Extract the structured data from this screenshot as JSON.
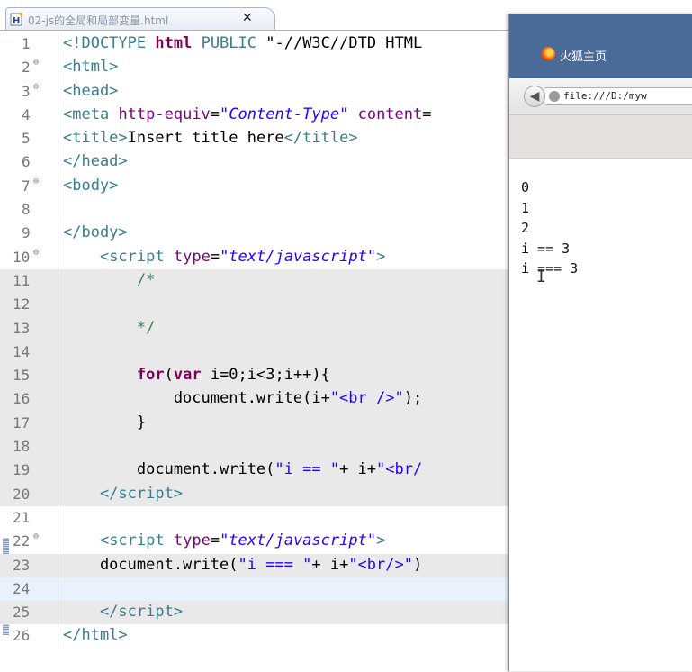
{
  "editor_tab": {
    "title": "02-js的全局和局部变量.html",
    "close_label": "✕"
  },
  "code_lines": [
    {
      "n": "1",
      "fold": "",
      "bg": "",
      "html": "<span class='tk-tag'>&lt;!DOCTYPE</span> <span class='tk-kw'>html</span> <span class='tk-tag'>PUBLIC</span> <span class='tk-str' style='color:#000'>\"-//W3C//DTD HTML</span>"
    },
    {
      "n": "2",
      "fold": "⊖",
      "bg": "",
      "html": "<span class='tk-tag'>&lt;html&gt;</span>"
    },
    {
      "n": "3",
      "fold": "⊖",
      "bg": "",
      "html": "<span class='tk-tag'>&lt;head&gt;</span>"
    },
    {
      "n": "4",
      "fold": "",
      "bg": "",
      "html": "<span class='tk-tag'>&lt;meta</span> <span class='tk-attr'>http-equiv</span>=<span class='tk-attrval'>\"Content-Type\"</span> <span class='tk-attr'>content</span>="
    },
    {
      "n": "5",
      "fold": "",
      "bg": "",
      "html": "<span class='tk-tag'>&lt;title&gt;</span>Insert title here<span class='tk-tag'>&lt;/title&gt;</span>"
    },
    {
      "n": "6",
      "fold": "",
      "bg": "",
      "html": "<span class='tk-tag'>&lt;/head&gt;</span>"
    },
    {
      "n": "7",
      "fold": "⊖",
      "bg": "",
      "html": "<span class='tk-tag'>&lt;body&gt;</span>"
    },
    {
      "n": "8",
      "fold": "",
      "bg": "",
      "html": ""
    },
    {
      "n": "9",
      "fold": "",
      "bg": "",
      "html": "<span class='tk-tag'>&lt;/body&gt;</span>"
    },
    {
      "n": "10",
      "fold": "⊖",
      "bg": "",
      "html": "    <span class='tk-tag'>&lt;script</span> <span class='tk-attr'>type</span>=<span class='tk-attrval'>\"text/javascript\"</span><span class='tk-tag'>&gt;</span>"
    },
    {
      "n": "11",
      "fold": "",
      "bg": "gray",
      "html": "        <span class='tk-cmt'>/*</span>"
    },
    {
      "n": "12",
      "fold": "",
      "bg": "gray",
      "html": ""
    },
    {
      "n": "13",
      "fold": "",
      "bg": "gray",
      "html": "        <span class='tk-cmt'>*/</span>"
    },
    {
      "n": "14",
      "fold": "",
      "bg": "gray",
      "html": ""
    },
    {
      "n": "15",
      "fold": "",
      "bg": "gray",
      "html": "        <span class='tk-kw'>for</span>(<span class='tk-kw'>var</span> i=0;i&lt;3;i++){"
    },
    {
      "n": "16",
      "fold": "",
      "bg": "gray",
      "html": "            document.write(i+<span class='tk-str'>\"&lt;br /&gt;\"</span>);"
    },
    {
      "n": "17",
      "fold": "",
      "bg": "gray",
      "html": "        }"
    },
    {
      "n": "18",
      "fold": "",
      "bg": "gray",
      "html": ""
    },
    {
      "n": "19",
      "fold": "",
      "bg": "gray",
      "html": "        document.write(<span class='tk-str'>\"i == \"</span>+ i+<span class='tk-str'>\"&lt;br/</span>"
    },
    {
      "n": "20",
      "fold": "",
      "bg": "gray",
      "html": "    <span class='tk-tag'>&lt;/script&gt;</span>"
    },
    {
      "n": "21",
      "fold": "",
      "bg": "",
      "html": ""
    },
    {
      "n": "22",
      "fold": "⊖",
      "bg": "",
      "html": "    <span class='tk-tag'>&lt;script</span> <span class='tk-attr'>type</span>=<span class='tk-attrval'>\"text/javascript\"</span><span class='tk-tag'>&gt;</span>"
    },
    {
      "n": "23",
      "fold": "",
      "bg": "gray",
      "html": "    document.write(<span class='tk-str'>\"i === \"</span>+ i+<span class='tk-str'>\"&lt;br/&gt;\"</span>)"
    },
    {
      "n": "24",
      "fold": "",
      "bg": "current",
      "html": ""
    },
    {
      "n": "25",
      "fold": "",
      "bg": "gray",
      "html": "    <span class='tk-tag'>&lt;/script&gt;</span>"
    },
    {
      "n": "26",
      "fold": "",
      "bg": "",
      "html": "<span class='tk-tag'>&lt;/html&gt;</span>"
    }
  ],
  "browser": {
    "title": "火狐主页",
    "url": "file:///D:/myw",
    "back_label": "◀",
    "output_lines": [
      "0",
      "1",
      "2",
      "i == 3",
      "i === 3"
    ]
  },
  "colors": {
    "titlebar": "#4a6a97",
    "gray_block": "#e9e9e9",
    "current_line": "#e8f2fe"
  },
  "icons": [
    "file-html-icon",
    "close-icon",
    "firefox-icon",
    "back-arrow-icon",
    "globe-icon",
    "fold-collapse-icon",
    "text-cursor-icon"
  ]
}
